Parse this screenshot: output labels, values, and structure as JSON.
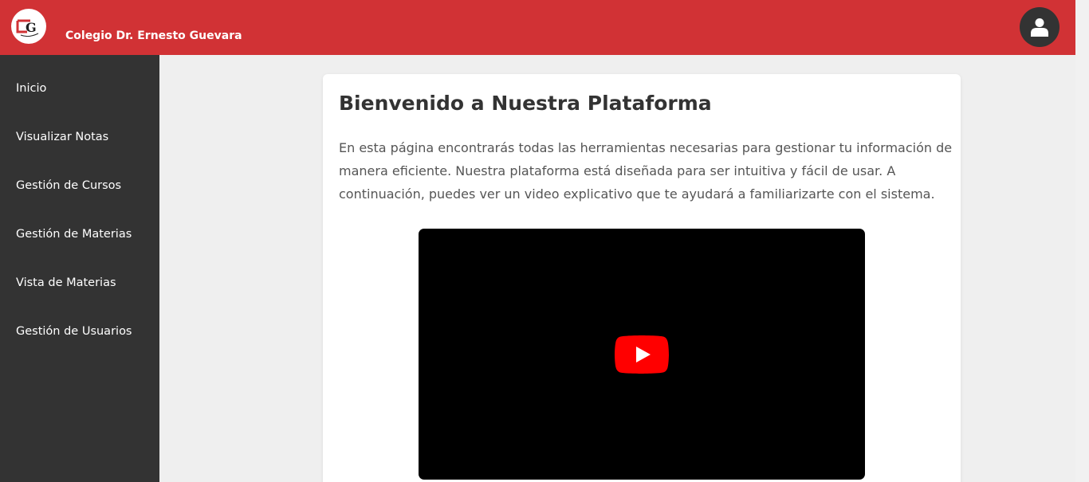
{
  "header": {
    "school_name": "Colegio Dr. Ernesto Guevara",
    "logo_icon": "school-logo-icon",
    "user_icon": "user-icon",
    "accent_color": "#d13235"
  },
  "sidebar": {
    "items": [
      {
        "label": "Inicio"
      },
      {
        "label": "Visualizar Notas"
      },
      {
        "label": "Gestión de Cursos"
      },
      {
        "label": "Gestión de Materias"
      },
      {
        "label": "Vista de Materias"
      },
      {
        "label": "Gestión de Usuarios"
      }
    ]
  },
  "main": {
    "title": "Bienvenido a Nuestra Plataforma",
    "description": "En esta página encontrarás todas las herramientas necesarias para gestionar tu información de manera eficiente. Nuestra plataforma está diseñada para ser intuitiva y fácil de usar. A continuación, puedes ver un video explicativo que te ayudará a familiarizarte con el sistema.",
    "video": {
      "play_icon": "youtube-play-icon",
      "play_color": "#ff0000"
    }
  }
}
